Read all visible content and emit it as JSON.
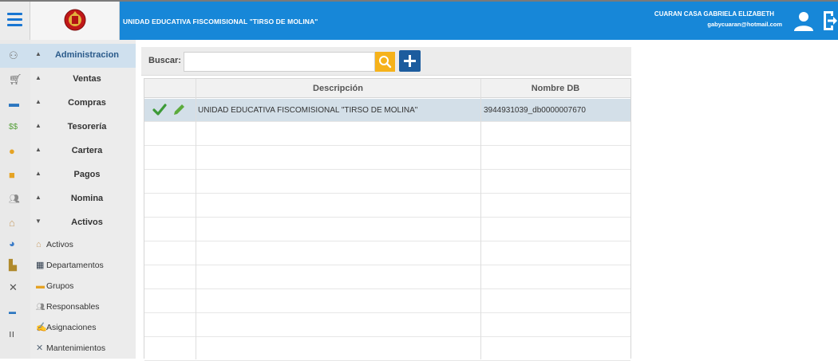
{
  "header": {
    "title": "UNIDAD EDUCATIVA FISCOMISIONAL \"TIRSO DE MOLINA\"",
    "user_name": "CUARAN CASA GABRIELA ELIZABETH",
    "user_email": "gabycuaran@hotmail.com",
    "brand_color": "#1787d8",
    "icons": [
      "hamburger-menu-icon",
      "school-crest-logo",
      "user-avatar-icon",
      "logout-icon"
    ]
  },
  "sidebar": {
    "items": [
      {
        "label": "Administracion",
        "icon": "admin-users-icon",
        "caret": "▲",
        "active": true
      },
      {
        "label": "Ventas",
        "icon": "cart-icon",
        "caret": "▲"
      },
      {
        "label": "Compras",
        "icon": "truck-icon",
        "caret": "▲"
      },
      {
        "label": "Tesorería",
        "icon": "money-icon",
        "caret": "▲"
      },
      {
        "label": "Cartera",
        "icon": "wallet-icon",
        "caret": "▲"
      },
      {
        "label": "Pagos",
        "icon": "payment-icon",
        "caret": "▲"
      },
      {
        "label": "Nomina",
        "icon": "people-icon",
        "caret": "▲"
      },
      {
        "label": "Activos",
        "icon": "house-icon",
        "caret": "▼"
      }
    ],
    "subitems": [
      {
        "label": "Activos",
        "icon": "house-icon"
      },
      {
        "label": "Departamentos",
        "icon": "building-icon"
      },
      {
        "label": "Grupos",
        "icon": "group-icon"
      },
      {
        "label": "Responsables",
        "icon": "people-icon"
      },
      {
        "label": "Asignaciones",
        "icon": "assign-icon"
      },
      {
        "label": "Mantenimientos",
        "icon": "tools-icon"
      }
    ]
  },
  "search": {
    "label": "Buscar:",
    "value": "",
    "placeholder": ""
  },
  "grid": {
    "columns": [
      "",
      "Descripción",
      "Nombre DB"
    ],
    "rows": [
      {
        "descripcion": "UNIDAD EDUCATIVA FISCOMISIONAL \"TIRSO DE MOLINA\"",
        "nombre_db": "3944931039_db0000007670",
        "selected": true
      }
    ]
  }
}
